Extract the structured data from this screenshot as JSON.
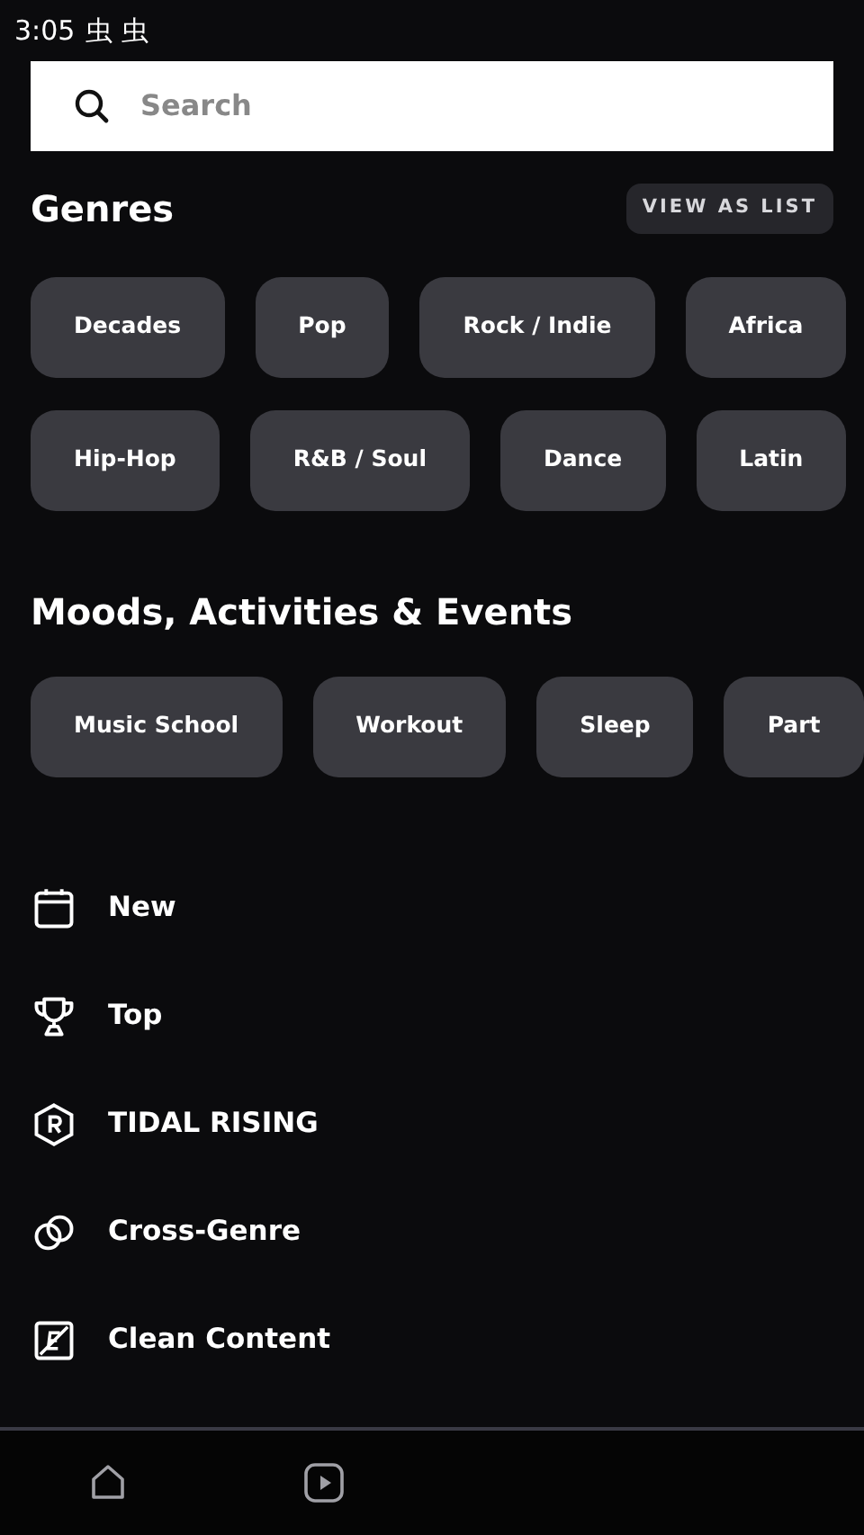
{
  "status_bar": {
    "time": "3:05",
    "notification_icons": "虫 虫"
  },
  "search": {
    "placeholder": "Search"
  },
  "genres": {
    "title": "Genres",
    "view_button": "VIEW AS LIST",
    "rows": [
      [
        "Decades",
        "Pop",
        "Rock / Indie",
        "Africa"
      ],
      [
        "Hip-Hop",
        "R&B / Soul",
        "Dance",
        "Latin"
      ]
    ]
  },
  "moods": {
    "title": "Moods, Activities & Events",
    "rows": [
      [
        "Music School",
        "Workout",
        "Sleep",
        "Part"
      ]
    ]
  },
  "links": [
    {
      "kind": "calendar",
      "label": "New"
    },
    {
      "kind": "trophy",
      "label": "Top"
    },
    {
      "kind": "rising",
      "label": "TIDAL RISING"
    },
    {
      "kind": "rings",
      "label": "Cross-Genre"
    },
    {
      "kind": "clean",
      "label": "Clean Content"
    }
  ],
  "bottom_nav": [
    {
      "kind": "home",
      "selected": false
    },
    {
      "kind": "video",
      "selected": false
    }
  ]
}
